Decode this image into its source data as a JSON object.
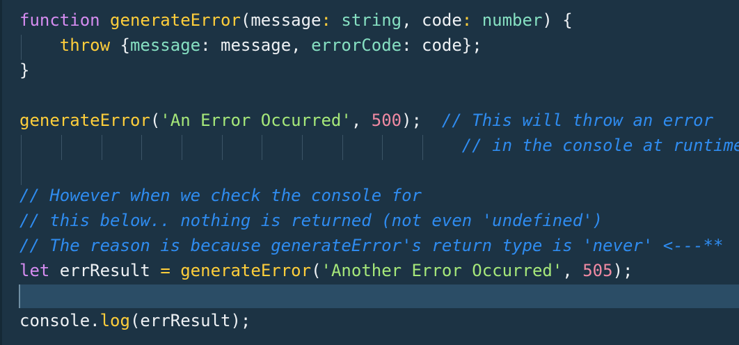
{
  "colors": {
    "background": "#1c3344",
    "keyword": "#d58cf0",
    "function": "#ffce3b",
    "type": "#86e0c2",
    "string": "#a6e87a",
    "number": "#f08aa3",
    "comment": "#2f8cf0",
    "plain": "#eef1f4",
    "current_line": "#2b4d66"
  },
  "lines": [
    [
      {
        "t": "function",
        "c": "kw"
      },
      {
        "t": " ",
        "c": "pl"
      },
      {
        "t": "generateError",
        "c": "fn"
      },
      {
        "t": "(message",
        "c": "pl"
      },
      {
        "t": ":",
        "c": "op"
      },
      {
        "t": " ",
        "c": "pl"
      },
      {
        "t": "string",
        "c": "ty"
      },
      {
        "t": ", code",
        "c": "pl"
      },
      {
        "t": ":",
        "c": "op"
      },
      {
        "t": " ",
        "c": "pl"
      },
      {
        "t": "number",
        "c": "ty"
      },
      {
        "t": ") {",
        "c": "pl"
      }
    ],
    [
      {
        "t": "    ",
        "c": "pl"
      },
      {
        "t": "throw",
        "c": "fn"
      },
      {
        "t": " {",
        "c": "pl"
      },
      {
        "t": "message",
        "c": "ty"
      },
      {
        "t": ": message, ",
        "c": "pl"
      },
      {
        "t": "errorCode",
        "c": "ty"
      },
      {
        "t": ": code};",
        "c": "pl"
      }
    ],
    [
      {
        "t": "}",
        "c": "pl"
      }
    ],
    [],
    [
      {
        "t": "generateError",
        "c": "fn"
      },
      {
        "t": "(",
        "c": "pl"
      },
      {
        "t": "'An Error Occurred'",
        "c": "str"
      },
      {
        "t": ", ",
        "c": "pl"
      },
      {
        "t": "500",
        "c": "num"
      },
      {
        "t": ");  ",
        "c": "pl"
      },
      {
        "t": "// This will throw an error",
        "c": "cm"
      }
    ],
    [
      {
        "t": "                                            ",
        "c": "pl"
      },
      {
        "t": "// in the console at runtime",
        "c": "cm"
      }
    ],
    [],
    [
      {
        "t": "// However when we check the console for",
        "c": "cm"
      }
    ],
    [
      {
        "t": "// this below.. nothing is returned (not even 'undefined')",
        "c": "cm"
      }
    ],
    [
      {
        "t": "// The reason is because generateError's return type is 'never' <---**",
        "c": "cm"
      }
    ],
    [
      {
        "t": "let",
        "c": "kw"
      },
      {
        "t": " errResult ",
        "c": "pl"
      },
      {
        "t": "=",
        "c": "op"
      },
      {
        "t": " ",
        "c": "pl"
      },
      {
        "t": "generateError",
        "c": "fn"
      },
      {
        "t": "(",
        "c": "pl"
      },
      {
        "t": "'Another Error Occurred'",
        "c": "str"
      },
      {
        "t": ", ",
        "c": "pl"
      },
      {
        "t": "505",
        "c": "num"
      },
      {
        "t": ");",
        "c": "pl"
      }
    ],
    [],
    [
      {
        "t": "console",
        "c": "pl"
      },
      {
        "t": ".",
        "c": "pl"
      },
      {
        "t": "log",
        "c": "fn"
      },
      {
        "t": "(errResult);",
        "c": "pl"
      }
    ]
  ]
}
